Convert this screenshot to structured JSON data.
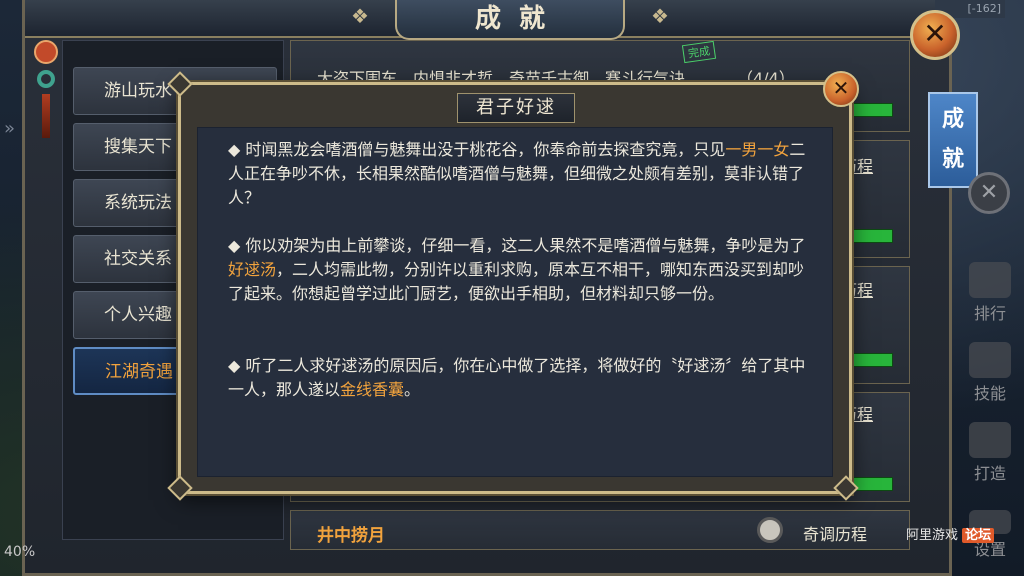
{
  "window": {
    "title": "成就",
    "close_label": "✕",
    "corner_tag": "[-162]"
  },
  "categories": [
    {
      "label": "游山玩水"
    },
    {
      "label": "搜集天下"
    },
    {
      "label": "系统玩法"
    },
    {
      "label": "社交关系"
    },
    {
      "label": "个人兴趣"
    },
    {
      "label": "江湖奇遇"
    }
  ],
  "list": {
    "row1_text": "大盗下围车、内惧非才哲、奇苗千古御、赛斗行气诀",
    "row1_progress": "（4/4）",
    "history_label": "历程",
    "last_title": "井中捞月",
    "last_history": "奇调历程",
    "stamp": "完成"
  },
  "side": {
    "tab_label_1": "成",
    "tab_label_2": "就",
    "close_glyph": "✕",
    "buttons": [
      {
        "label": "排行"
      },
      {
        "label": "技能"
      },
      {
        "label": "打造"
      },
      {
        "label": "设置"
      }
    ]
  },
  "status": {
    "battery": "40%"
  },
  "watermark": {
    "text": "阿里游戏",
    "badge": "论坛"
  },
  "popup": {
    "title": "君子好逑",
    "close_label": "✕",
    "p1_a": "◆ 时闻黑龙会嗜酒僧与魅舞出没于桃花谷，你奉命前去探查究竟，只见",
    "p1_hl": "一男一女",
    "p1_b": "二人正在争吵不休，长相果然酷似嗜酒僧与魅舞，但细微之处颇有差别，莫非认错了人？",
    "p2_a": "◆ 你以劝架为由上前攀谈，仔细一看，这二人果然不是嗜酒僧与魅舞，争吵是为了",
    "p2_hl": "好逑汤",
    "p2_b": "，二人均需此物，分别许以重利求购，原本互不相干，哪知东西没买到却吵了起来。你想起曾学过此门厨艺，便欲出手相助，但材料却只够一份。",
    "p3_a": "◆ 听了二人求好逑汤的原因后，你在心中做了选择，将做好的〝好逑汤〞给了其中一人，那人遂以",
    "p3_hl": "金线香囊",
    "p3_b": "。"
  }
}
